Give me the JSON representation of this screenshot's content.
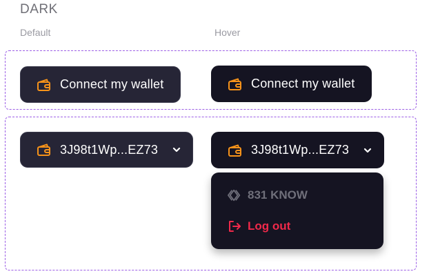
{
  "section": {
    "title": "DARK"
  },
  "columns": {
    "default": "Default",
    "hover": "Hover"
  },
  "connect_button": {
    "label": "Connect my wallet",
    "icon": "wallet-icon"
  },
  "address_button": {
    "label": "3J98t1Wp...EZ73",
    "icon": "wallet-icon",
    "chevron": "chevron-down-icon"
  },
  "dropdown": {
    "balance": {
      "label": "831 KNOW",
      "icon": "token-icon"
    },
    "logout": {
      "label": "Log out",
      "icon": "logout-icon"
    }
  },
  "colors": {
    "accent": "#F7931A",
    "button_default_bg": "#262536",
    "button_hover_bg": "#151422",
    "frame_border": "#9B5DE5",
    "logout": "#F0294A"
  }
}
